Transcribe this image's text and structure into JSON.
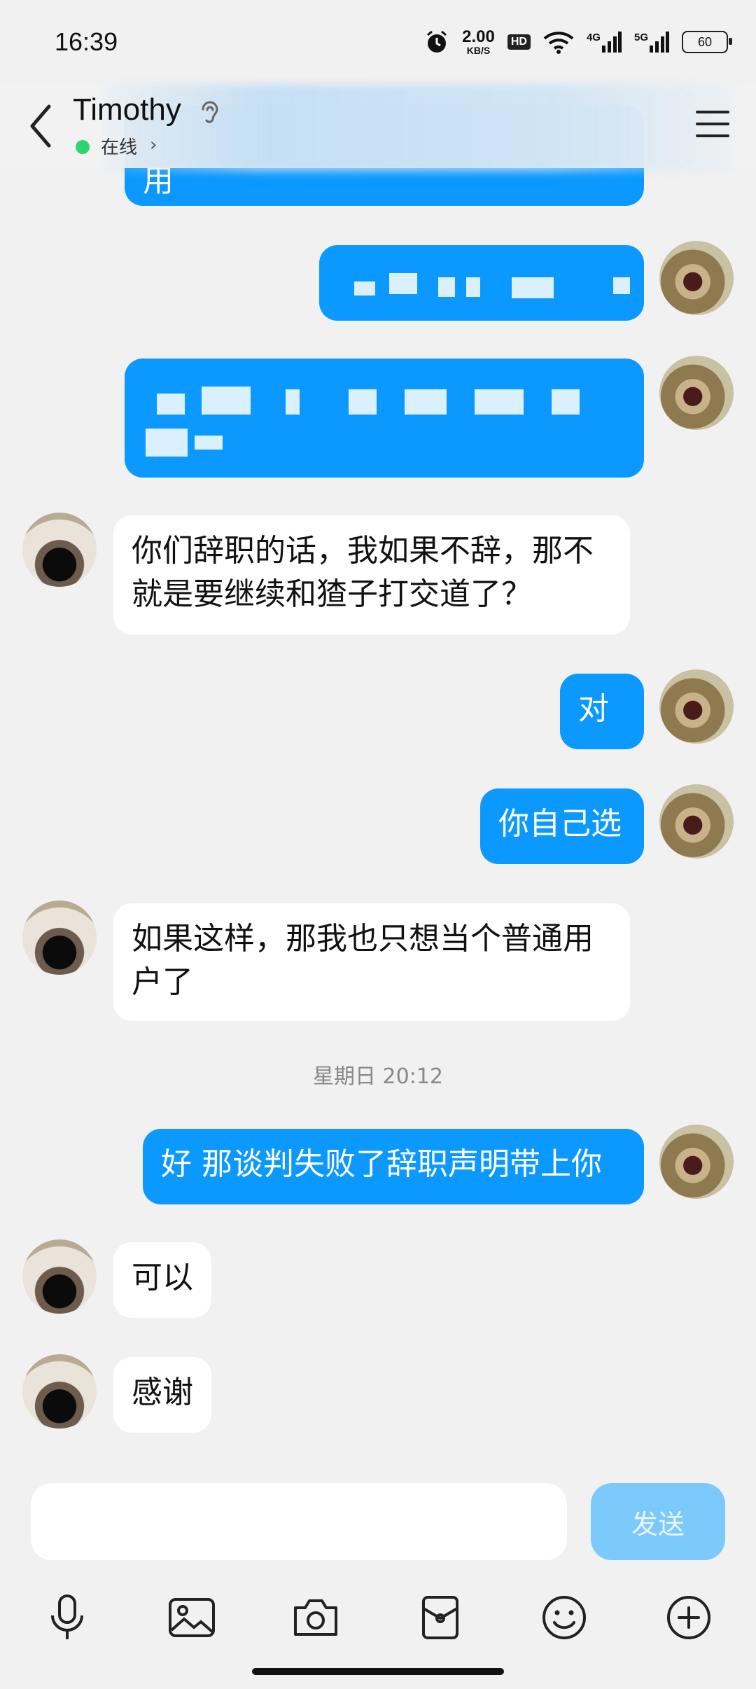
{
  "status_bar": {
    "time": "16:39",
    "net_speed": "2.00",
    "net_unit": "KB/S",
    "hd": "HD",
    "signal_4g": "4G",
    "signal_5g": "5G",
    "battery": "60"
  },
  "header": {
    "contact_name": "Timothy",
    "presence": "在线",
    "presence_color": "#2ed46f"
  },
  "messages": [
    {
      "side": "out",
      "text": "用"
    },
    {
      "side": "out",
      "text": ""
    },
    {
      "side": "out",
      "text": ""
    },
    {
      "side": "in",
      "text": "你们辞职的话，我如果不辞，那不就是要继续和猹子打交道了？"
    },
    {
      "side": "out",
      "text": "对"
    },
    {
      "side": "out",
      "text": "你自己选"
    },
    {
      "side": "in",
      "text": "如果这样，那我也只想当个普通用户了"
    },
    {
      "side": "out",
      "text": "好  那谈判失败了辞职声明带上你"
    },
    {
      "side": "in",
      "text": "可以"
    },
    {
      "side": "in",
      "text": "感谢"
    }
  ],
  "timestamp": "星期日 20:12",
  "composer": {
    "placeholder": "",
    "send_label": "发送",
    "send_color": "#7cc9fb"
  },
  "toolbar_icons": [
    "microphone-icon",
    "image-icon",
    "camera-icon",
    "red-packet-icon",
    "emoji-icon",
    "plus-icon"
  ],
  "colors": {
    "outgoing_bubble": "#0b99ff",
    "incoming_bubble": "#ffffff",
    "background": "#f1f1f1"
  }
}
